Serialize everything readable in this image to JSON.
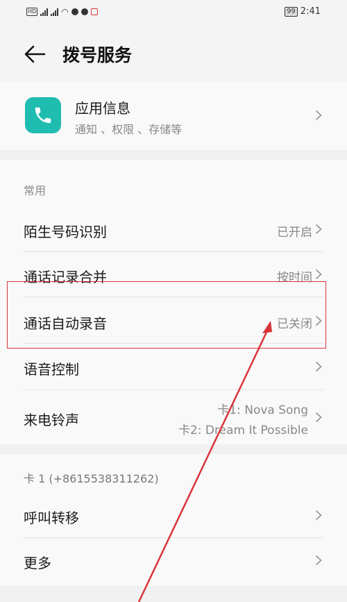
{
  "status_bar": {
    "left_chips": [
      "HD",
      "4G",
      "4G"
    ],
    "battery": "99",
    "time": "2:41"
  },
  "header": {
    "title": "拨号服务",
    "back_icon": "back-arrow-icon"
  },
  "app_info": {
    "title": "应用信息",
    "subtitle": "通知 、权限 、存储等",
    "icon": "phone-icon",
    "icon_color": "#1fbcb0"
  },
  "common": {
    "section_label": "常用",
    "items": [
      {
        "label": "陌生号码识别",
        "value": "已开启"
      },
      {
        "label": "通话记录合并",
        "value": "按时间"
      },
      {
        "label": "通话自动录音",
        "value": "已关闭"
      },
      {
        "label": "语音控制",
        "value": ""
      },
      {
        "label": "来电铃声",
        "value_line1": "卡1: Nova Song",
        "value_line2": "卡2: Dream It Possible"
      }
    ]
  },
  "card1": {
    "section_label": "卡 1 (+8615538311262)",
    "items": [
      {
        "label": "呼叫转移"
      },
      {
        "label": "更多"
      }
    ]
  },
  "annotation": {
    "color": "#d8353a"
  }
}
